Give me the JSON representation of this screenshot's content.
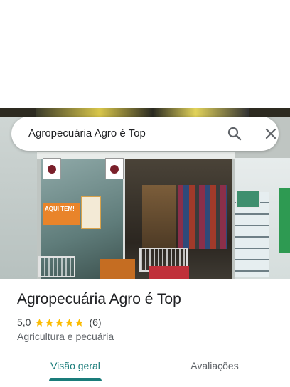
{
  "search": {
    "value": "Agropecuária Agro é Top"
  },
  "place": {
    "name": "Agropecuária Agro é Top",
    "rating": "5,0",
    "stars": 5,
    "review_count": "(6)",
    "category": "Agricultura e pecuária"
  },
  "photo_text": {
    "poster": "AQUI TEM!"
  },
  "tabs": [
    {
      "label": "Visão geral",
      "selected": true
    },
    {
      "label": "Avaliações",
      "selected": false
    }
  ],
  "colors": {
    "accent": "#1a7c7a",
    "star": "#fbbc04"
  },
  "icons": {
    "search": "search-icon",
    "close": "close-icon",
    "star": "star-icon"
  }
}
